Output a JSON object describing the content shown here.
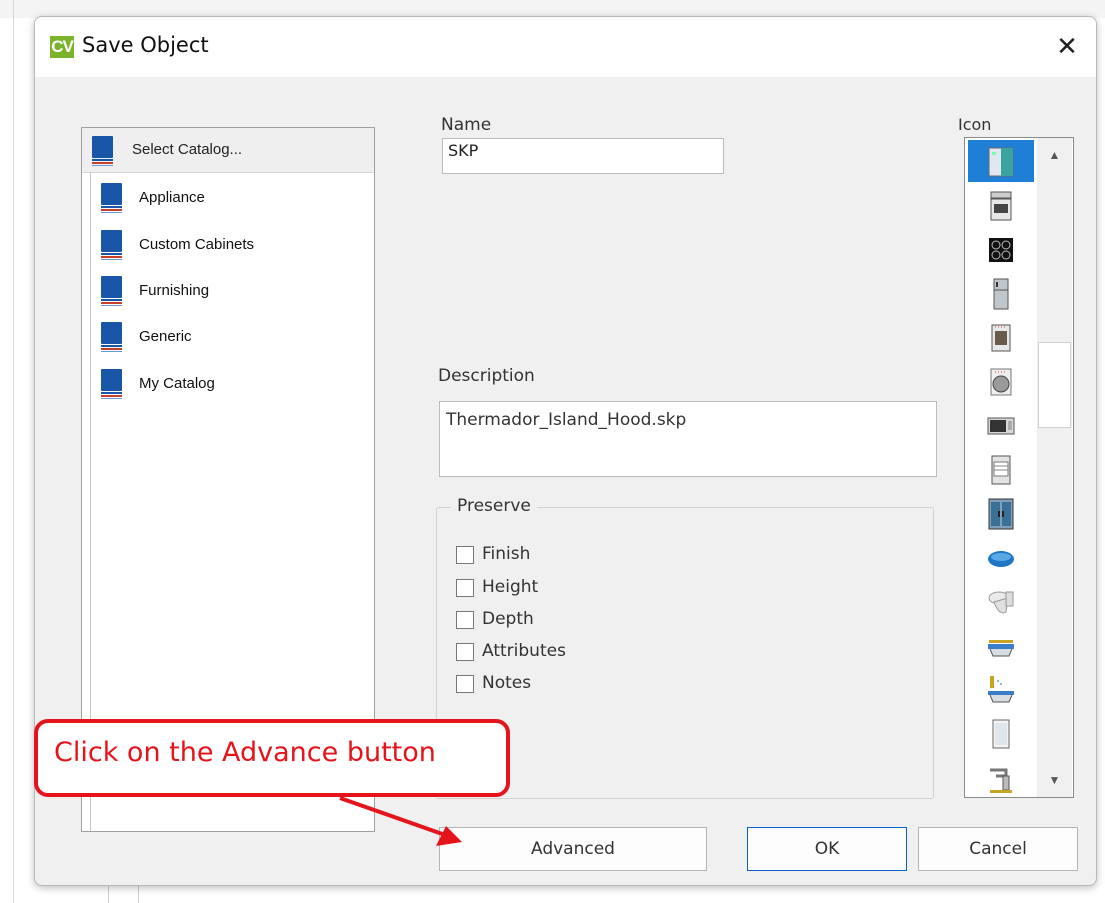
{
  "dialog": {
    "app_icon_text": "CV",
    "title": "Save Object",
    "close_glyph": "✕"
  },
  "catalog": {
    "header": "Select Catalog...",
    "items": [
      {
        "label": "Appliance"
      },
      {
        "label": "Custom Cabinets"
      },
      {
        "label": "Furnishing"
      },
      {
        "label": "Generic"
      },
      {
        "label": "My Catalog"
      }
    ]
  },
  "name": {
    "label": "Name",
    "value": "SKP"
  },
  "description": {
    "label": "Description",
    "value": "Thermador_Island_Hood.skp"
  },
  "preserve": {
    "legend": "Preserve",
    "options": [
      {
        "label": "Finish",
        "checked": false
      },
      {
        "label": "Height",
        "checked": false
      },
      {
        "label": "Depth",
        "checked": false
      },
      {
        "label": "Attributes",
        "checked": false
      },
      {
        "label": "Notes",
        "checked": false
      }
    ]
  },
  "icon_panel": {
    "label": "Icon",
    "selected_index": 0,
    "icons": [
      "fridge-freezer-icon",
      "range-oven-icon",
      "cooktop-icon",
      "tall-fridge-icon",
      "wall-oven-icon",
      "round-burner-icon",
      "microwave-icon",
      "dishwasher-icon",
      "double-door-fridge-icon",
      "round-sink-icon",
      "toilet-icon",
      "bathtub-icon",
      "shower-tub-icon",
      "shower-panel-icon",
      "faucet-icon"
    ],
    "scroll_up_glyph": "▲",
    "scroll_down_glyph": "▼"
  },
  "buttons": {
    "advanced": "Advanced",
    "ok": "OK",
    "cancel": "Cancel"
  },
  "callout": {
    "text": "Click on the Advance button",
    "color": "#e5141b"
  }
}
